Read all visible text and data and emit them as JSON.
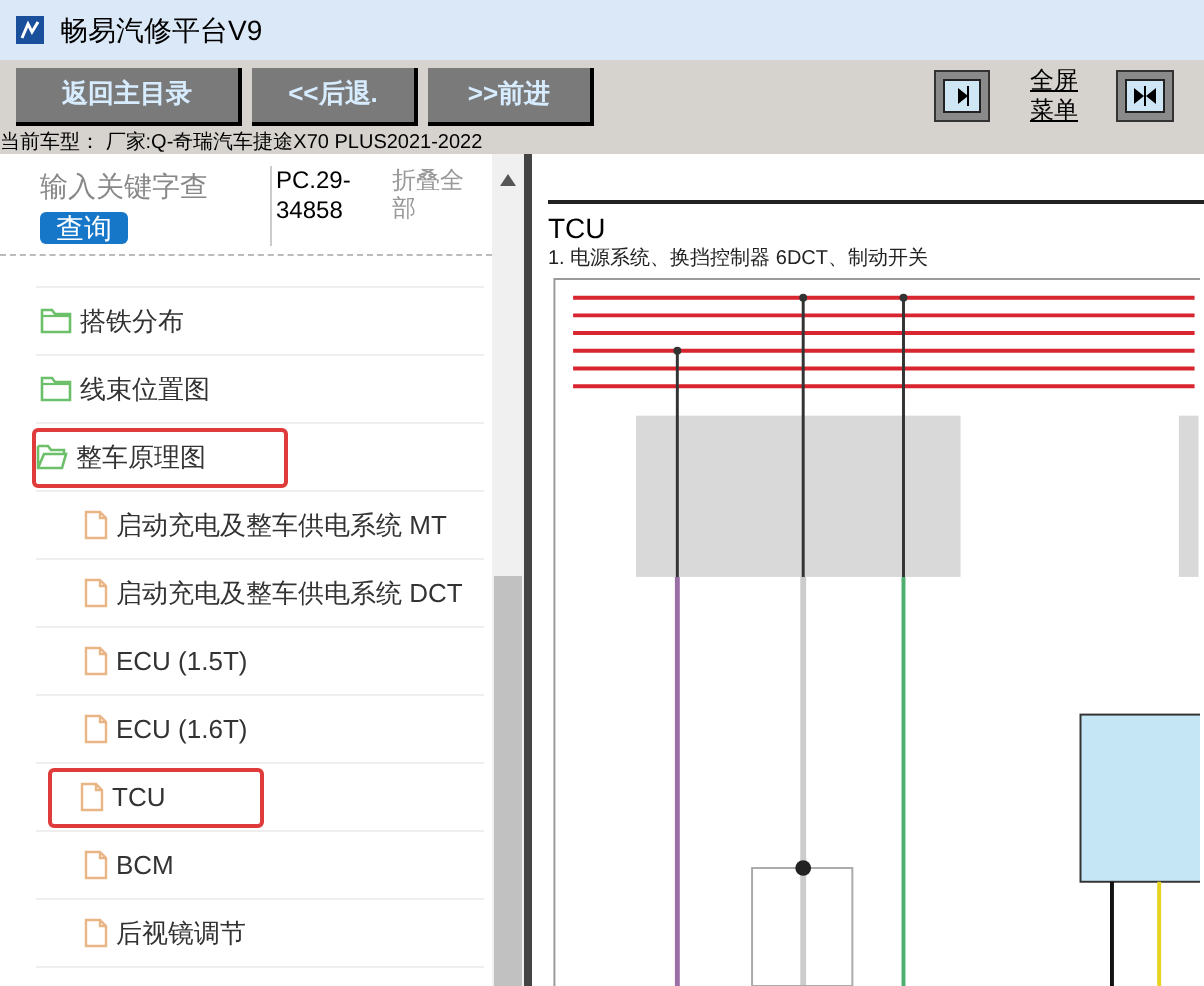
{
  "window": {
    "title": "畅易汽修平台V9"
  },
  "toolbar": {
    "buttons": [
      "返回主目录",
      "<<后退.",
      ">>前进"
    ],
    "fullscreen_menu": [
      "全屏",
      "菜单"
    ]
  },
  "vehicle_line": "当前车型： 厂家:Q-奇瑞汽车捷途X70 PLUS2021-2022",
  "sidebar": {
    "search_placeholder": "输入关键字查",
    "search_button": "查询",
    "doc_code": "PC.29-34858",
    "collapse_all": "折叠全部",
    "items": [
      {
        "label": "搭铁分布",
        "kind": "folder",
        "expanded": false,
        "highlighted": false
      },
      {
        "label": "线束位置图",
        "kind": "folder",
        "expanded": false,
        "highlighted": false
      },
      {
        "label": "整车原理图",
        "kind": "folder",
        "expanded": true,
        "highlighted": true,
        "children": [
          {
            "label": "启动充电及整车供电系统 MT",
            "kind": "file",
            "highlighted": false
          },
          {
            "label": "启动充电及整车供电系统 DCT",
            "kind": "file",
            "highlighted": false
          },
          {
            "label": "ECU (1.5T)",
            "kind": "file",
            "highlighted": false
          },
          {
            "label": "ECU (1.6T)",
            "kind": "file",
            "highlighted": false
          },
          {
            "label": "TCU",
            "kind": "file",
            "highlighted": true
          },
          {
            "label": "BCM",
            "kind": "file",
            "highlighted": false
          },
          {
            "label": "后视镜调节",
            "kind": "file",
            "highlighted": false
          }
        ]
      }
    ]
  },
  "document": {
    "title": "TCU",
    "subtitle": "1. 电源系统、换挡控制器 6DCT、制动开关"
  }
}
